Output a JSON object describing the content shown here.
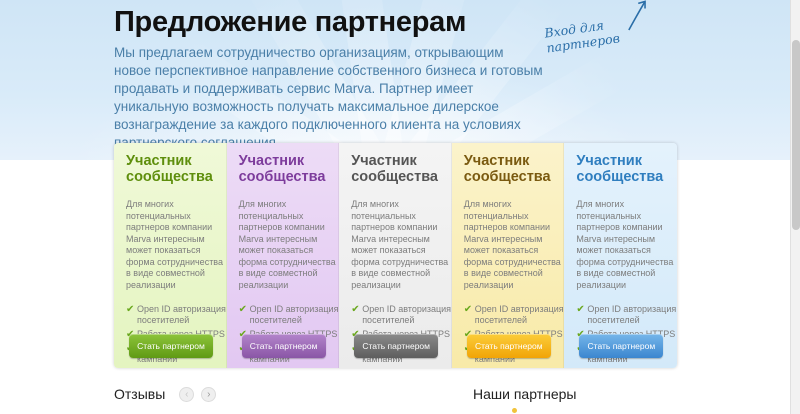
{
  "header": {
    "title": "Предложение партнерам",
    "intro": "Мы предлагаем сотрудничество организациям, открывающим новое перспективное направление собственного бизнеса и готовым продавать и поддерживать сервис Marva. Партнер имеет уникальную возможность получать максимальное дилерское вознаграждение за каждого подключенного клиента на условиях партнерского соглашения.",
    "partner_login_line1": "Вход для",
    "partner_login_line2": "партнеров"
  },
  "cards": [
    {
      "title_line1": "Участник",
      "title_line2": "сообщества",
      "description": "Для многих потенциальных партнеров компании Marva интересным может показаться форма сотрудничества в виде совместной реализации",
      "features": [
        "Open ID авторизация посетителей",
        "Работа через HTTPS",
        "Рекламные кампании"
      ],
      "button": "Стать партнером",
      "theme": "#8dc43a"
    },
    {
      "title_line1": "Участник",
      "title_line2": "сообщества",
      "description": "Для многих потенциальных партнеров компании Marva интересным может показаться форма сотрудничества в виде совместной реализации",
      "features": [
        "Open ID авторизация посетителей",
        "Работа через HTTPS",
        "Рекламные кампании"
      ],
      "button": "Стать партнером",
      "theme": "#b384cb"
    },
    {
      "title_line1": "Участник",
      "title_line2": "сообщества",
      "description": "Для многих потенциальных партнеров компании Marva интересным может показаться форма сотрудничества в виде совместной реализации",
      "features": [
        "Open ID авторизация посетителей",
        "Работа через HTTPS",
        "Рекламные кампании"
      ],
      "button": "Стать партнером",
      "theme": "#8a8a8a"
    },
    {
      "title_line1": "Участник",
      "title_line2": "сообщества",
      "description": "Для многих потенциальных партнеров компании Marva интересным может показаться форма сотрудничества в виде совместной реализации",
      "features": [
        "Open ID авторизация посетителей",
        "Работа через HTTPS",
        "Рекламные кампании"
      ],
      "button": "Стать партнером",
      "theme": "#fbcd3a"
    },
    {
      "title_line1": "Участник",
      "title_line2": "сообщества",
      "description": "Для многих потенциальных партнеров компании Marva интересным может показаться форма сотрудничества в виде совместной реализации",
      "features": [
        "Open ID авторизация посетителей",
        "Работа через HTTPS",
        "Рекламные кампании"
      ],
      "button": "Стать партнером",
      "theme": "#75b6ea"
    }
  ],
  "reviews": {
    "title": "Отзывы",
    "prev_icon": "arrow-left-icon",
    "next_icon": "arrow-right-icon"
  },
  "partners": {
    "title": "Наши партнеры"
  },
  "icons": {
    "check": "check-icon",
    "login_arrow": "arrow-up-right-icon"
  }
}
